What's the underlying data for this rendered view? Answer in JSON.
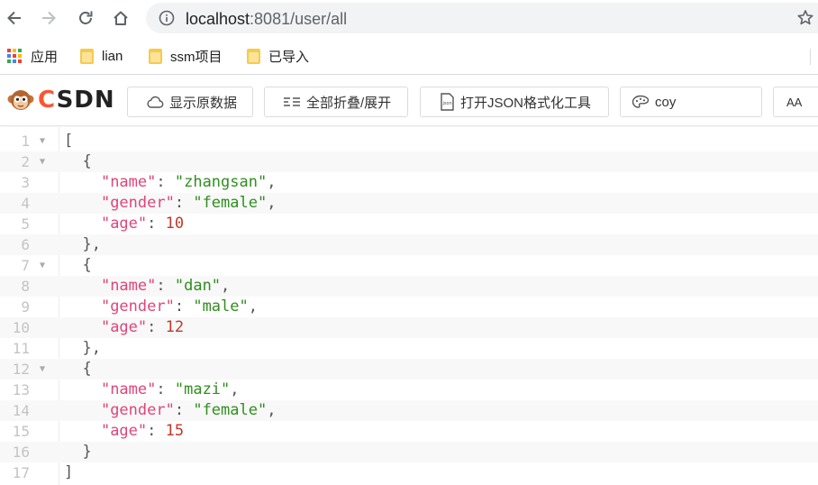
{
  "browser": {
    "url_host": "localhost",
    "url_rest": ":8081/user/all"
  },
  "bookmarks": [
    {
      "label": "应用"
    },
    {
      "label": "lian"
    },
    {
      "label": "ssm项目"
    },
    {
      "label": "已导入"
    }
  ],
  "extension": {
    "logo_text_c": "C",
    "logo_text_rest": "SDN",
    "buttons": {
      "show_raw": "显示原数据",
      "fold_all": "全部折叠/展开",
      "open_tool": "打开JSON格式化工具",
      "search_value": "coy",
      "font_button": "AA"
    }
  },
  "json_view": {
    "lines": [
      {
        "num": "1",
        "foldable": true
      },
      {
        "num": "2",
        "foldable": true
      },
      {
        "num": "3",
        "foldable": false
      },
      {
        "num": "4",
        "foldable": false
      },
      {
        "num": "5",
        "foldable": false
      },
      {
        "num": "6",
        "foldable": false
      },
      {
        "num": "7",
        "foldable": true
      },
      {
        "num": "8",
        "foldable": false
      },
      {
        "num": "9",
        "foldable": false
      },
      {
        "num": "10",
        "foldable": false
      },
      {
        "num": "11",
        "foldable": false
      },
      {
        "num": "12",
        "foldable": true
      },
      {
        "num": "13",
        "foldable": false
      },
      {
        "num": "14",
        "foldable": false
      },
      {
        "num": "15",
        "foldable": false
      },
      {
        "num": "16",
        "foldable": false
      },
      {
        "num": "17",
        "foldable": false
      }
    ],
    "users": [
      {
        "name": "zhangsan",
        "gender": "female",
        "age": "10"
      },
      {
        "name": "dan",
        "gender": "male",
        "age": "12"
      },
      {
        "name": "mazi",
        "gender": "female",
        "age": "15"
      }
    ],
    "keys": {
      "name": "\"name\"",
      "gender": "\"gender\"",
      "age": "\"age\""
    }
  }
}
